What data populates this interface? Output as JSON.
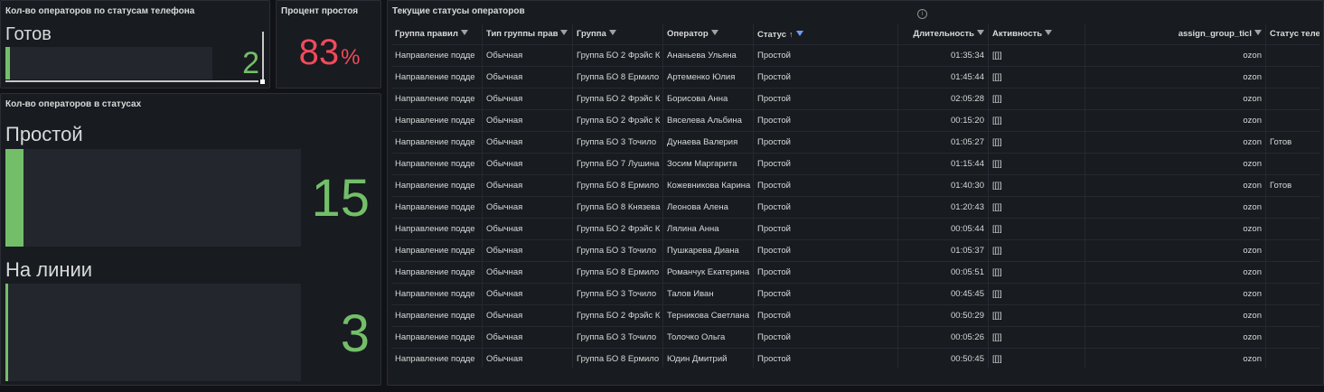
{
  "panel_phone": {
    "title": "Кол-во операторов по статусам телефона",
    "label": "Готов",
    "value": "2",
    "level": 0.02
  },
  "panel_idle": {
    "title": "Процент простоя",
    "value": "83",
    "unit": "%"
  },
  "panel_status_count": {
    "title": "Кол-во операторов в статусах",
    "items": [
      {
        "label": "Простой",
        "value": "15",
        "level": 0.06
      },
      {
        "label": "На линии",
        "value": "3",
        "level": 0.01
      }
    ]
  },
  "table_panel": {
    "title": "Текущие статусы операторов",
    "info_icon": "info-icon",
    "columns": [
      "Группа правил",
      "Тип группы прав",
      "Группа",
      "Оператор",
      "Статус",
      "Длительность",
      "Активность",
      "assign_group_ticl",
      "Статус теле"
    ],
    "sorted_column": "Статус",
    "rows": [
      [
        "Направление подде",
        "Обычная",
        "Группа БО 2 Фрэйс К",
        "Ананьева Ульяна",
        "Простой",
        "01:35:34",
        "[[]]",
        "ozon",
        ""
      ],
      [
        "Направление подде",
        "Обычная",
        "Группа БО 8 Ермило",
        "Артеменко Юлия",
        "Простой",
        "01:45:44",
        "[[]]",
        "ozon",
        ""
      ],
      [
        "Направление подде",
        "Обычная",
        "Группа БО 2 Фрэйс К",
        "Борисова Анна",
        "Простой",
        "02:05:28",
        "[[]]",
        "ozon",
        ""
      ],
      [
        "Направление подде",
        "Обычная",
        "Группа БО 2 Фрэйс К",
        "Вяселева Альбина",
        "Простой",
        "00:15:20",
        "[[]]",
        "ozon",
        ""
      ],
      [
        "Направление подде",
        "Обычная",
        "Группа БО 3 Точило",
        "Дунаева Валерия",
        "Простой",
        "01:05:27",
        "[[]]",
        "ozon",
        "Готов"
      ],
      [
        "Направление подде",
        "Обычная",
        "Группа БО 7 Лушина",
        "Зосим Маргарита",
        "Простой",
        "01:15:44",
        "[[]]",
        "ozon",
        ""
      ],
      [
        "Направление подде",
        "Обычная",
        "Группа БО 8 Ермило",
        "Кожевникова Карина",
        "Простой",
        "01:40:30",
        "[[]]",
        "ozon",
        "Готов"
      ],
      [
        "Направление подде",
        "Обычная",
        "Группа БО 8 Князева",
        "Леонова Алена",
        "Простой",
        "01:20:43",
        "[[]]",
        "ozon",
        ""
      ],
      [
        "Направление подде",
        "Обычная",
        "Группа БО 2 Фрэйс К",
        "Лялина Анна",
        "Простой",
        "00:05:44",
        "[[]]",
        "ozon",
        ""
      ],
      [
        "Направление подде",
        "Обычная",
        "Группа БО 3 Точило",
        "Пушкарева Диана",
        "Простой",
        "01:05:37",
        "[[]]",
        "ozon",
        ""
      ],
      [
        "Направление подде",
        "Обычная",
        "Группа БО 8 Ермило",
        "Романчук Екатерина",
        "Простой",
        "00:05:51",
        "[[]]",
        "ozon",
        ""
      ],
      [
        "Направление подде",
        "Обычная",
        "Группа БО 3 Точило",
        "Талов Иван",
        "Простой",
        "00:45:45",
        "[[]]",
        "ozon",
        ""
      ],
      [
        "Направление подде",
        "Обычная",
        "Группа БО 2 Фрэйс К",
        "Терникова Светлана",
        "Простой",
        "00:50:29",
        "[[]]",
        "ozon",
        ""
      ],
      [
        "Направление подде",
        "Обычная",
        "Группа БО 3 Точило",
        "Толочко Ольга",
        "Простой",
        "00:05:26",
        "[[]]",
        "ozon",
        ""
      ],
      [
        "Направление подде",
        "Обычная",
        "Группа БО 8 Ермило",
        "Юдин Дмитрий",
        "Простой",
        "00:50:45",
        "[[]]",
        "ozon",
        ""
      ]
    ]
  },
  "colors": {
    "background": "#111217",
    "panel": "#181b1f",
    "green": "#73bf69",
    "red": "#f2495c",
    "filter_active": "#6e9fff"
  }
}
